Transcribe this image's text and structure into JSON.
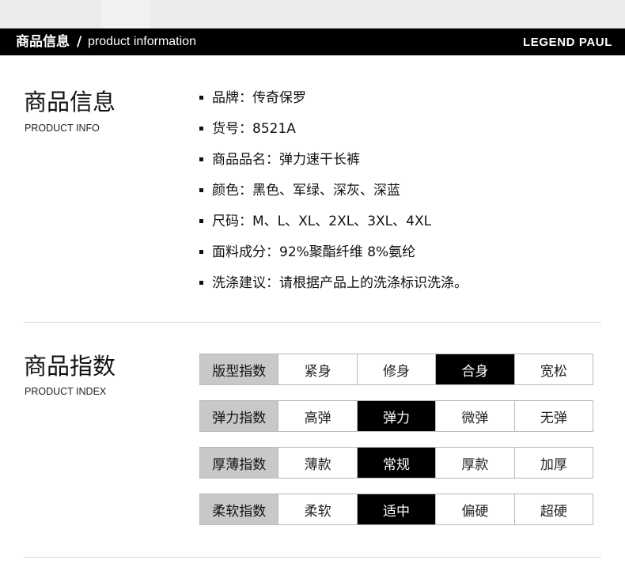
{
  "header": {
    "title_cn": "商品信息",
    "separator": "/",
    "title_en": "product information",
    "brand": "LEGEND PAUL"
  },
  "product_info": {
    "title": "商品信息",
    "subtitle": "PRODUCT INFO",
    "items": [
      "品牌：传奇保罗",
      "货号：8521A",
      "商品品名：弹力速干长裤",
      "颜色：黑色、军绿、深灰、深蓝",
      "尺码：M、L、XL、2XL、3XL、4XL",
      "面料成分：92%聚酯纤维 8%氨纶",
      "洗涤建议：请根据产品上的洗涤标识洗涤。"
    ]
  },
  "product_index": {
    "title": "商品指数",
    "subtitle": "PRODUCT INDEX",
    "rows": [
      {
        "label": "版型指数",
        "options": [
          "紧身",
          "修身",
          "合身",
          "宽松"
        ],
        "selected": 2
      },
      {
        "label": "弹力指数",
        "options": [
          "高弹",
          "弹力",
          "微弹",
          "无弹"
        ],
        "selected": 1
      },
      {
        "label": "厚薄指数",
        "options": [
          "薄款",
          "常规",
          "厚款",
          "加厚"
        ],
        "selected": 1
      },
      {
        "label": "柔软指数",
        "options": [
          "柔软",
          "适中",
          "偏硬",
          "超硬"
        ],
        "selected": 1
      }
    ]
  },
  "colors": {
    "header_bg": "#000000",
    "label_cell_bg": "#c8c8c8",
    "selected_cell_bg": "#000000"
  }
}
